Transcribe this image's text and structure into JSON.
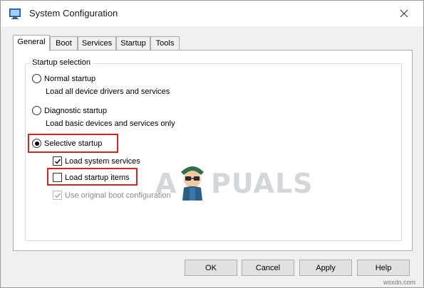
{
  "window": {
    "title": "System Configuration",
    "icon": "system-config-icon",
    "close_icon": "close-icon"
  },
  "tabs": [
    {
      "label": "General",
      "active": true
    },
    {
      "label": "Boot",
      "active": false
    },
    {
      "label": "Services",
      "active": false
    },
    {
      "label": "Startup",
      "active": false
    },
    {
      "label": "Tools",
      "active": false
    }
  ],
  "startup_selection": {
    "group_label": "Startup selection",
    "normal": {
      "label": "Normal startup",
      "description": "Load all device drivers and services",
      "selected": false
    },
    "diagnostic": {
      "label": "Diagnostic startup",
      "description": "Load basic devices and services only",
      "selected": false
    },
    "selective": {
      "label": "Selective startup",
      "selected": true
    },
    "options": {
      "load_system_services": {
        "label": "Load system services",
        "checked": true,
        "enabled": true
      },
      "load_startup_items": {
        "label": "Load startup items",
        "checked": false,
        "enabled": true
      },
      "use_original_boot": {
        "label": "Use original boot configuration",
        "checked": true,
        "enabled": false
      }
    }
  },
  "buttons": {
    "ok": "OK",
    "cancel": "Cancel",
    "apply": "Apply",
    "help": "Help"
  },
  "watermark": {
    "text_left": "A",
    "text_right": "PUALS"
  },
  "site_label": "wsxdn.com",
  "colors": {
    "highlight": "#d9261c",
    "watermark": "#d3d7db"
  }
}
